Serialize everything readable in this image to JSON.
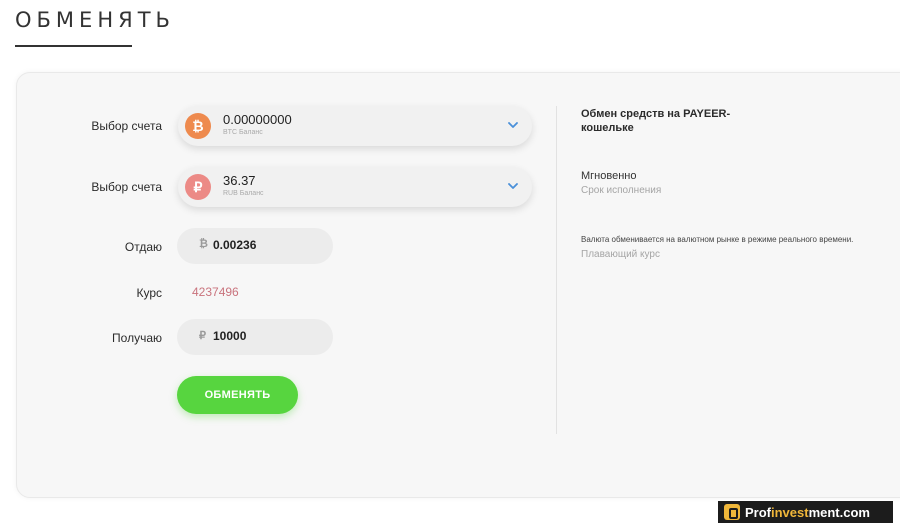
{
  "page": {
    "title": "ОБМЕНЯТЬ"
  },
  "form": {
    "account_label_1": "Выбор счета",
    "account_label_2": "Выбор счета",
    "from_account": {
      "amount": "0.00000000",
      "subtitle": "BTC Баланс",
      "icon": "bitcoin-icon",
      "icon_glyph": "₿",
      "color": "#ee8a4e"
    },
    "to_account": {
      "amount": "36.37",
      "subtitle": "RUB Баланс",
      "icon": "ruble-icon",
      "icon_glyph": "₽",
      "color": "#ec8a86"
    },
    "give_label": "Отдаю",
    "give_currency": "₿",
    "give_value": "0.00236",
    "rate_label": "Курс",
    "rate_value": "4237496",
    "receive_label": "Получаю",
    "receive_currency": "₽",
    "receive_value": "10000",
    "submit_label": "ОБМЕНЯТЬ"
  },
  "info": {
    "title": "Обмен средств на PAYEER-кошельке",
    "speed_value": "Мгновенно",
    "speed_label": "Срок исполнения",
    "rate_note": "Валюта обменивается на валютном рынке в режиме реального времени.",
    "rate_type": "Плавающий курс"
  },
  "watermark": {
    "prefix": "Prof",
    "accent": "invest",
    "suffix": "ment.com"
  },
  "colors": {
    "accent_green": "#57d53f",
    "rate_color": "#c9737d",
    "chevron": "#4a90d9"
  }
}
